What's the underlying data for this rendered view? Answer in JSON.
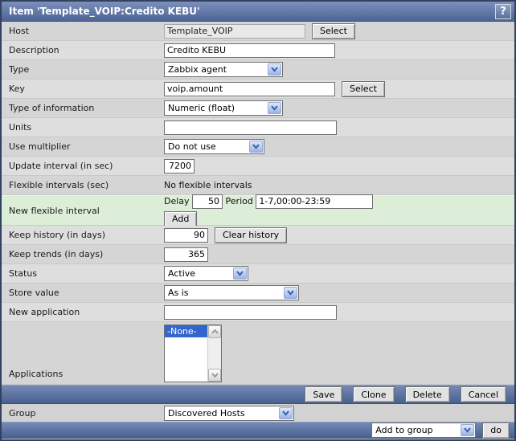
{
  "window": {
    "title": "Item 'Template_VOIP:Credito KEBU'",
    "help_label": "?"
  },
  "form": {
    "host": {
      "label": "Host",
      "value": "Template_VOIP",
      "select_button": "Select"
    },
    "description": {
      "label": "Description",
      "value": "Credito KEBU"
    },
    "type": {
      "label": "Type",
      "value": "Zabbix agent"
    },
    "key": {
      "label": "Key",
      "value": "voip.amount",
      "select_button": "Select"
    },
    "type_of_information": {
      "label": "Type of information",
      "value": "Numeric (float)"
    },
    "units": {
      "label": "Units",
      "value": ""
    },
    "use_multiplier": {
      "label": "Use multiplier",
      "value": "Do not use"
    },
    "update_interval": {
      "label": "Update interval (in sec)",
      "value": "7200"
    },
    "flexible_intervals": {
      "label": "Flexible intervals (sec)",
      "value": "No flexible intervals"
    },
    "new_flexible_interval": {
      "label": "New flexible interval",
      "delay_label": "Delay",
      "delay_value": "50",
      "period_label": "Period",
      "period_value": "1-7,00:00-23:59",
      "add_button": "Add"
    },
    "keep_history": {
      "label": "Keep history (in days)",
      "value": "90",
      "clear_button": "Clear history"
    },
    "keep_trends": {
      "label": "Keep trends (in days)",
      "value": "365"
    },
    "status": {
      "label": "Status",
      "value": "Active"
    },
    "store_value": {
      "label": "Store value",
      "value": "As is"
    },
    "new_application": {
      "label": "New application",
      "value": ""
    },
    "applications": {
      "label": "Applications",
      "options": [
        "-None-"
      ],
      "selected": "-None-"
    }
  },
  "footer_buttons": {
    "save": "Save",
    "clone": "Clone",
    "delete": "Delete",
    "cancel": "Cancel"
  },
  "group_row": {
    "label": "Group",
    "value": "Discovered Hosts"
  },
  "action_bar": {
    "select_value": "Add to group",
    "do_button": "do"
  },
  "colors": {
    "titlebar_blue_top": "#7c90ba",
    "titlebar_blue_bottom": "#4d6496",
    "row_dark": "#d5d5d5",
    "row_light": "#dedede",
    "flexible_row_green": "#dcedd8",
    "selection_blue": "#3366cc",
    "window_border": "#32415f"
  }
}
